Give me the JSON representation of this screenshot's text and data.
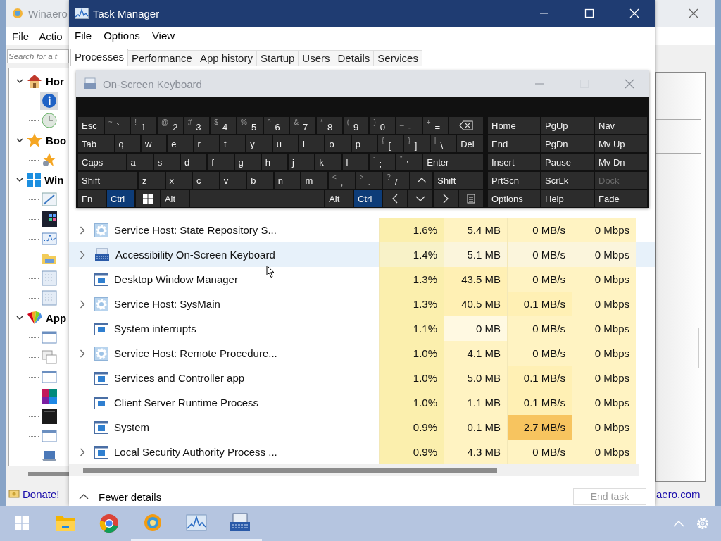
{
  "background_window": {
    "title": "Winaero",
    "menu": [
      "File",
      "Actio"
    ],
    "search": {
      "placeholder": "Search for a t"
    },
    "tree": [
      {
        "label": "Hor",
        "kind": "home",
        "expanded": true,
        "children": [
          {
            "kind": "info",
            "selected": true
          },
          {
            "kind": "clock",
            "selected": false
          }
        ]
      },
      {
        "label": "Boo",
        "kind": "star",
        "expanded": true,
        "children": [
          {
            "kind": "star",
            "selected": false
          }
        ]
      },
      {
        "label": "Win",
        "kind": "windows",
        "expanded": true,
        "children": [
          {
            "kind": "pen",
            "selected": false
          },
          {
            "kind": "tiles",
            "selected": false
          },
          {
            "kind": "chart",
            "selected": false
          },
          {
            "kind": "folder",
            "selected": false
          },
          {
            "kind": "grid",
            "selected": false
          },
          {
            "kind": "grid",
            "selected": false
          }
        ]
      },
      {
        "label": "App",
        "kind": "palette",
        "expanded": true,
        "children": [
          {
            "kind": "window",
            "selected": false
          },
          {
            "kind": "windows2",
            "selected": false
          },
          {
            "kind": "window",
            "selected": false
          },
          {
            "kind": "colors",
            "selected": false
          },
          {
            "kind": "dark",
            "selected": false
          },
          {
            "kind": "window",
            "selected": false
          },
          {
            "kind": "laptop",
            "selected": false
          }
        ]
      }
    ],
    "status": {
      "link": "Donate!",
      "right_link": "aero.com"
    }
  },
  "task_manager": {
    "title": "Task Manager",
    "menu": [
      "File",
      "Options",
      "View"
    ],
    "tabs": [
      {
        "label": "Processes",
        "selected": true
      },
      {
        "label": "Performance",
        "selected": false
      },
      {
        "label": "App history",
        "selected": false
      },
      {
        "label": "Startup",
        "selected": false
      },
      {
        "label": "Users",
        "selected": false
      },
      {
        "label": "Details",
        "selected": false
      },
      {
        "label": "Services",
        "selected": false
      }
    ],
    "rows": [
      {
        "name": "Service Host: State Repository S...",
        "kind": "gear",
        "expandable": true,
        "selected": false,
        "cells": [
          {
            "text": "1.6%",
            "color": "#fbefad"
          },
          {
            "text": "5.4 MB",
            "color": "#fff3c2"
          },
          {
            "text": "0 MB/s",
            "color": "#fff3c2"
          },
          {
            "text": "0 Mbps",
            "color": "#fff3c2"
          }
        ]
      },
      {
        "name": "Accessibility On-Screen Keyboard",
        "kind": "keyboard",
        "expandable": true,
        "selected": true,
        "cells": [
          {
            "text": "1.4%",
            "color": "#f8f2c8"
          },
          {
            "text": "5.1 MB",
            "color": "#fbf5dc"
          },
          {
            "text": "0 MB/s",
            "color": "#fbf5dc"
          },
          {
            "text": "0 Mbps",
            "color": "#fbf5dc"
          }
        ]
      },
      {
        "name": "Desktop Window Manager",
        "kind": "window",
        "expandable": false,
        "selected": false,
        "cells": [
          {
            "text": "1.3%",
            "color": "#fbefad"
          },
          {
            "text": "43.5 MB",
            "color": "#fff0b4"
          },
          {
            "text": "0 MB/s",
            "color": "#fff3c2"
          },
          {
            "text": "0 Mbps",
            "color": "#fff3c2"
          }
        ]
      },
      {
        "name": "Service Host: SysMain",
        "kind": "gear",
        "expandable": true,
        "selected": false,
        "cells": [
          {
            "text": "1.3%",
            "color": "#fbefad"
          },
          {
            "text": "40.5 MB",
            "color": "#fff0b4"
          },
          {
            "text": "0.1 MB/s",
            "color": "#fff0b4"
          },
          {
            "text": "0 Mbps",
            "color": "#fff3c2"
          }
        ]
      },
      {
        "name": "System interrupts",
        "kind": "window",
        "expandable": false,
        "selected": false,
        "cells": [
          {
            "text": "1.1%",
            "color": "#fbefad"
          },
          {
            "text": "0 MB",
            "color": "#fff9e2"
          },
          {
            "text": "0 MB/s",
            "color": "#fff3c2"
          },
          {
            "text": "0 Mbps",
            "color": "#fff3c2"
          }
        ]
      },
      {
        "name": "Service Host: Remote Procedure...",
        "kind": "gear",
        "expandable": true,
        "selected": false,
        "cells": [
          {
            "text": "1.0%",
            "color": "#fbefad"
          },
          {
            "text": "4.1 MB",
            "color": "#fff3c2"
          },
          {
            "text": "0 MB/s",
            "color": "#fff3c2"
          },
          {
            "text": "0 Mbps",
            "color": "#fff3c2"
          }
        ]
      },
      {
        "name": "Services and Controller app",
        "kind": "window",
        "expandable": false,
        "selected": false,
        "cells": [
          {
            "text": "1.0%",
            "color": "#fbefad"
          },
          {
            "text": "5.0 MB",
            "color": "#fff3c2"
          },
          {
            "text": "0.1 MB/s",
            "color": "#fff0b4"
          },
          {
            "text": "0 Mbps",
            "color": "#fff3c2"
          }
        ]
      },
      {
        "name": "Client Server Runtime Process",
        "kind": "window",
        "expandable": false,
        "selected": false,
        "cells": [
          {
            "text": "1.0%",
            "color": "#fbefad"
          },
          {
            "text": "1.1 MB",
            "color": "#fff3c2"
          },
          {
            "text": "0.1 MB/s",
            "color": "#fff0b4"
          },
          {
            "text": "0 Mbps",
            "color": "#fff3c2"
          }
        ]
      },
      {
        "name": "System",
        "kind": "window",
        "expandable": false,
        "selected": false,
        "cells": [
          {
            "text": "0.9%",
            "color": "#fbefad"
          },
          {
            "text": "0.1 MB",
            "color": "#fff3c2"
          },
          {
            "text": "2.7 MB/s",
            "color": "#f7c45f"
          },
          {
            "text": "0 Mbps",
            "color": "#fff3c2"
          }
        ]
      },
      {
        "name": "Local Security Authority Process ...",
        "kind": "window",
        "expandable": true,
        "selected": false,
        "cells": [
          {
            "text": "0.9%",
            "color": "#fbefad"
          },
          {
            "text": "4.3 MB",
            "color": "#fff3c2"
          },
          {
            "text": "0 MB/s",
            "color": "#fff3c2"
          },
          {
            "text": "0 Mbps",
            "color": "#fff3c2"
          }
        ]
      }
    ],
    "fewer_details": "Fewer details",
    "end_task": {
      "label": "End task",
      "disabled": true
    }
  },
  "osk": {
    "title": "On-Screen Keyboard",
    "main_rows": [
      [
        {
          "label": "Esc",
          "kind": "key",
          "selected": false
        },
        {
          "shift": "~",
          "label": "`",
          "kind": "key",
          "selected": false
        },
        {
          "shift": "!",
          "label": "1",
          "kind": "key",
          "selected": false
        },
        {
          "shift": "@",
          "label": "2",
          "kind": "key",
          "selected": false
        },
        {
          "shift": "#",
          "label": "3",
          "kind": "key",
          "selected": false
        },
        {
          "shift": "$",
          "label": "4",
          "kind": "key",
          "selected": false
        },
        {
          "shift": "%",
          "label": "5",
          "kind": "key",
          "selected": false
        },
        {
          "shift": "^",
          "label": "6",
          "kind": "key",
          "selected": false
        },
        {
          "shift": "&",
          "label": "7",
          "kind": "key",
          "selected": false
        },
        {
          "shift": "*",
          "label": "8",
          "kind": "key",
          "selected": false
        },
        {
          "shift": "(",
          "label": "9",
          "kind": "key",
          "selected": false
        },
        {
          "shift": ")",
          "label": "0",
          "kind": "key",
          "selected": false
        },
        {
          "shift": "_",
          "label": "-",
          "kind": "key",
          "selected": false
        },
        {
          "shift": "+",
          "label": "=",
          "kind": "key",
          "selected": false
        },
        {
          "kind": "backspace",
          "selected": false
        }
      ],
      [
        {
          "label": "Tab",
          "kind": "key",
          "selected": false
        },
        {
          "label": "q",
          "kind": "key",
          "selected": false
        },
        {
          "label": "w",
          "kind": "key",
          "selected": false
        },
        {
          "label": "e",
          "kind": "key",
          "selected": false
        },
        {
          "label": "r",
          "kind": "key",
          "selected": false
        },
        {
          "label": "t",
          "kind": "key",
          "selected": false
        },
        {
          "label": "y",
          "kind": "key",
          "selected": false
        },
        {
          "label": "u",
          "kind": "key",
          "selected": false
        },
        {
          "label": "i",
          "kind": "key",
          "selected": false
        },
        {
          "label": "o",
          "kind": "key",
          "selected": false
        },
        {
          "label": "p",
          "kind": "key",
          "selected": false
        },
        {
          "shift": "{",
          "label": "[",
          "kind": "key",
          "selected": false
        },
        {
          "shift": "}",
          "label": "]",
          "kind": "key",
          "selected": false
        },
        {
          "shift": "|",
          "label": "\\",
          "kind": "key",
          "selected": false
        },
        {
          "label": "Del",
          "kind": "key",
          "selected": false
        }
      ],
      [
        {
          "label": "Caps",
          "kind": "key",
          "selected": false
        },
        {
          "label": "a",
          "kind": "key",
          "selected": false
        },
        {
          "label": "s",
          "kind": "key",
          "selected": false
        },
        {
          "label": "d",
          "kind": "key",
          "selected": false
        },
        {
          "label": "f",
          "kind": "key",
          "selected": false
        },
        {
          "label": "g",
          "kind": "key",
          "selected": false
        },
        {
          "label": "h",
          "kind": "key",
          "selected": false
        },
        {
          "label": "j",
          "kind": "key",
          "selected": false
        },
        {
          "label": "k",
          "kind": "key",
          "selected": false
        },
        {
          "label": "l",
          "kind": "key",
          "selected": false
        },
        {
          "shift": ":",
          "label": ";",
          "kind": "key",
          "selected": false
        },
        {
          "shift": "\"",
          "label": "'",
          "kind": "key",
          "selected": false
        },
        {
          "label": "Enter",
          "kind": "key",
          "selected": false
        }
      ],
      [
        {
          "label": "Shift",
          "kind": "key",
          "selected": false
        },
        {
          "label": "z",
          "kind": "key",
          "selected": false
        },
        {
          "label": "x",
          "kind": "key",
          "selected": false
        },
        {
          "label": "c",
          "kind": "key",
          "selected": false
        },
        {
          "label": "v",
          "kind": "key",
          "selected": false
        },
        {
          "label": "b",
          "kind": "key",
          "selected": false
        },
        {
          "label": "n",
          "kind": "key",
          "selected": false
        },
        {
          "label": "m",
          "kind": "key",
          "selected": false
        },
        {
          "shift": "<",
          "label": ",",
          "kind": "key",
          "selected": false
        },
        {
          "shift": ">",
          "label": ".",
          "kind": "key",
          "selected": false
        },
        {
          "shift": "?",
          "label": "/",
          "kind": "key",
          "selected": false
        },
        {
          "kind": "arrow-up",
          "selected": false
        },
        {
          "label": "Shift",
          "kind": "key",
          "selected": false
        }
      ],
      [
        {
          "label": "Fn",
          "kind": "key",
          "selected": false
        },
        {
          "label": "Ctrl",
          "kind": "key",
          "selected": true
        },
        {
          "kind": "windows",
          "selected": false
        },
        {
          "label": "Alt",
          "kind": "key",
          "selected": false
        },
        {
          "kind": "space",
          "selected": false
        },
        {
          "label": "Alt",
          "kind": "key",
          "selected": false
        },
        {
          "label": "Ctrl",
          "kind": "key",
          "selected": true
        },
        {
          "kind": "arrow-left",
          "selected": false
        },
        {
          "kind": "arrow-down",
          "selected": false
        },
        {
          "kind": "arrow-right",
          "selected": false
        },
        {
          "kind": "menu",
          "selected": false
        }
      ]
    ],
    "nav_rows": [
      [
        {
          "label": "Home",
          "disabled": false
        },
        {
          "label": "PgUp",
          "disabled": false
        },
        {
          "label": "Nav",
          "disabled": false
        }
      ],
      [
        {
          "label": "End",
          "disabled": false
        },
        {
          "label": "PgDn",
          "disabled": false
        },
        {
          "label": "Mv Up",
          "disabled": false
        }
      ],
      [
        {
          "label": "Insert",
          "disabled": false
        },
        {
          "label": "Pause",
          "disabled": false
        },
        {
          "label": "Mv Dn",
          "disabled": false
        }
      ],
      [
        {
          "label": "PrtScn",
          "disabled": false
        },
        {
          "label": "ScrLk",
          "disabled": false
        },
        {
          "label": "Dock",
          "disabled": true
        }
      ],
      [
        {
          "label": "Options",
          "disabled": false
        },
        {
          "label": "Help",
          "disabled": false
        },
        {
          "label": "Fade",
          "disabled": false
        }
      ]
    ]
  },
  "taskbar": {
    "items": [
      {
        "kind": "start",
        "running": false
      },
      {
        "kind": "folder",
        "running": false
      },
      {
        "kind": "browser",
        "running": false
      },
      {
        "kind": "swirl",
        "running": true
      },
      {
        "kind": "monitor",
        "running": true
      },
      {
        "kind": "keyboard",
        "running": true
      }
    ]
  }
}
